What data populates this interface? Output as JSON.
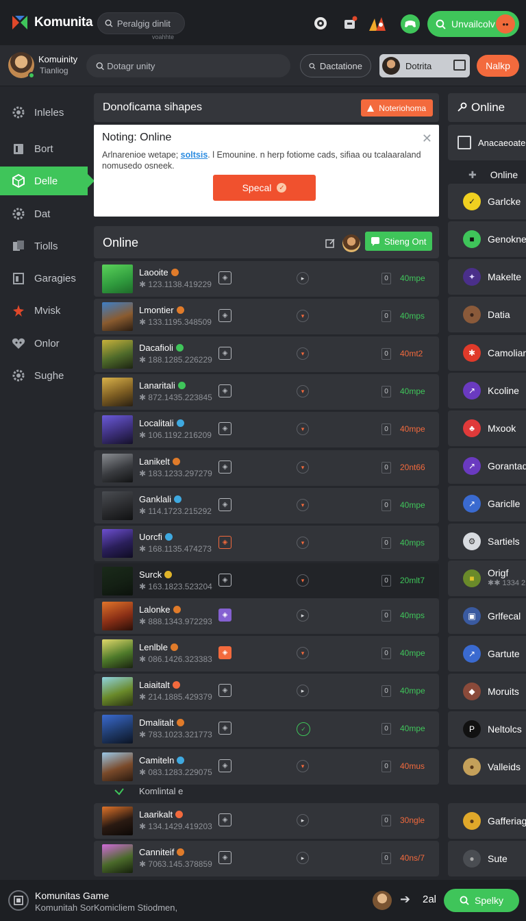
{
  "app": {
    "brand_name": "Komunita",
    "search_placeholder": "Peralgig dinlit",
    "search_hint": "voahhte",
    "cta_label": "Unvailcolv"
  },
  "subheader": {
    "user_name": "Komuinity",
    "user_sub": "Tianliog",
    "search_placeholder": "Dotagr unity",
    "pill_label": "Dactatione",
    "account_label": "Dotrita",
    "action_label": "Nalkp"
  },
  "sidebar": {
    "items": [
      {
        "label": "Inleles",
        "icon": "gear-icon"
      },
      {
        "label": "Bort",
        "icon": "book-icon"
      },
      {
        "label": "Delle",
        "icon": "cube-icon"
      },
      {
        "label": "Dat",
        "icon": "gear-icon"
      },
      {
        "label": "Tiolls",
        "icon": "cards-icon"
      },
      {
        "label": "Garagies",
        "icon": "garage-icon"
      },
      {
        "label": "Mvisk",
        "icon": "star-icon"
      },
      {
        "label": "Onlor",
        "icon": "heart-icon"
      },
      {
        "label": "Sughe",
        "icon": "gear-icon"
      }
    ],
    "active_index": 2
  },
  "notification": {
    "title": "Donoficama sihapes",
    "tag_label": "Noteriohoma",
    "dialog_title": "Noting: Online",
    "dialog_text_before": "Arlnarenioe wetape;",
    "dialog_link": "soltsis",
    "dialog_text_after": ". l Emounine. n herp fotiome cads, sifiaa ou tcalaaraland nomusedo osneek.",
    "dialog_button": "Specal"
  },
  "online": {
    "title": "Online",
    "chip_label": "Stieng Ont",
    "section_label": "Komlintal e",
    "rows": [
      {
        "name": "Laooite",
        "id": "✱ 123.1138.419229",
        "status": "neutral",
        "count": "0",
        "time": "40mpe",
        "time_color": "#3fc55a",
        "badge": "#e07b2a",
        "shield": "plain",
        "thumb": "linear-gradient(160deg,#5ad25a,#2f9a3d 60%,#1f6a2a)"
      },
      {
        "name": "Lmontier",
        "id": "✱ 133.1195.348509",
        "status": "red",
        "count": "0",
        "time": "40mps",
        "time_color": "#3fc55a",
        "badge": "#e07b2a",
        "shield": "plain",
        "thumb": "linear-gradient(160deg,#3d7fc7,#8a5b2f 55%,#2a1d12)"
      },
      {
        "name": "Dacafioli",
        "id": "✱ 188.1285.226229",
        "status": "red",
        "count": "0",
        "time": "40mt2",
        "time_color": "#f36a3d",
        "badge": "#3fc55a",
        "shield": "plain",
        "thumb": "linear-gradient(160deg,#c7b13b,#4e6a2a 55%,#1d2412)"
      },
      {
        "name": "Lanaritali",
        "id": "✱ 872.1435.223845",
        "status": "red",
        "count": "0",
        "time": "40mpe",
        "time_color": "#3fc55a",
        "badge": "#3fc55a",
        "shield": "plain",
        "thumb": "linear-gradient(160deg,#d9b24a,#7d5d22 55%,#2a2012)"
      },
      {
        "name": "Localitali",
        "id": "✱ 106.1192.216209",
        "status": "red",
        "count": "0",
        "time": "40mpe",
        "time_color": "#f36a3d",
        "badge": "#3fa9e0",
        "shield": "plain",
        "thumb": "linear-gradient(160deg,#6a5ad9,#3c2f7a 55%,#15112a)"
      },
      {
        "name": "Lanikelt",
        "id": "✱ 183.1233.297279",
        "status": "red",
        "count": "0",
        "time": "20nt66",
        "time_color": "#f36a3d",
        "badge": "#e07b2a",
        "shield": "plain",
        "thumb": "linear-gradient(160deg,#8a8d92,#3a3c40 55%,#121314)"
      },
      {
        "name": "Ganklali",
        "id": "✱ 114.1723.215292",
        "status": "red",
        "count": "0",
        "time": "40mpe",
        "time_color": "#3fc55a",
        "badge": "#3fa9e0",
        "shield": "plain",
        "thumb": "linear-gradient(160deg,#4a4d52,#2a2b2e 55%,#101112)"
      },
      {
        "name": "Uorcfi",
        "id": "✱ 168.1135.474273",
        "status": "red",
        "count": "0",
        "time": "40mps",
        "time_color": "#3fc55a",
        "badge": "#3fa9e0",
        "shield": "red-outline",
        "thumb": "linear-gradient(160deg,#6d4fd0,#2a1f5a 55%,#0f0c22)"
      },
      {
        "name": "Surck",
        "id": "✱ 163.1823.523204",
        "status": "red",
        "count": "0",
        "time": "20mlt7",
        "time_color": "#3fc55a",
        "badge": "#e0b42a",
        "shield": "plain",
        "thumb": "linear-gradient(160deg,#1a2a1a,#142014 55%,#0c120c)",
        "dark": true
      },
      {
        "name": "Lalonke",
        "id": "✱ 888.1343.972293",
        "status": "neutral",
        "count": "0",
        "time": "40mps",
        "time_color": "#3fc55a",
        "badge": "#e07b2a",
        "shield": "purple",
        "thumb": "linear-gradient(160deg,#e0742a,#8a2f16 55%,#2a0f08)"
      },
      {
        "name": "Lenlble",
        "id": "✱ 086.1426.323383",
        "status": "red",
        "count": "0",
        "time": "40mpe",
        "time_color": "#3fc55a",
        "badge": "#e07b2a",
        "shield": "red",
        "thumb": "linear-gradient(160deg,#e0d86a,#4e7a2a 55%,#1a2410)"
      },
      {
        "name": "Laiaitalt",
        "id": "✱ 214.1885.429379",
        "status": "neutral",
        "count": "0",
        "time": "40mpe",
        "time_color": "#3fc55a",
        "badge": "#f36a3d",
        "shield": "plain",
        "thumb": "linear-gradient(160deg,#8fd3e0,#6a8a2a 55%,#2a3412)"
      },
      {
        "name": "Dmalitalt",
        "id": "✱ 783.1023.321773",
        "status": "green",
        "count": "0",
        "time": "40mpe",
        "time_color": "#3fc55a",
        "badge": "#e07b2a",
        "shield": "plain",
        "thumb": "linear-gradient(160deg,#3a6ad0,#1f3a6a 55%,#0c1424)"
      },
      {
        "name": "Camiteln",
        "id": "✱ 083.1283.229075",
        "status": "red",
        "count": "0",
        "time": "40mus",
        "time_color": "#f36a3d",
        "badge": "#3fa9e0",
        "shield": "plain",
        "thumb": "linear-gradient(160deg,#9ac8e8,#7a4a2a 55%,#2a1a10)"
      },
      {
        "name": "Laarikalt",
        "id": "✱ 134.1429.419203",
        "status": "neutral",
        "count": "0",
        "time": "30ngle",
        "time_color": "#f36a3d",
        "badge": "#f36a3d",
        "shield": "plain",
        "thumb": "linear-gradient(160deg,#e0742a,#2a1a12 55%,#0c0806)"
      },
      {
        "name": "Canniteif",
        "id": "✱ 7063.145.378859",
        "status": "neutral",
        "count": "0",
        "time": "40ns/7",
        "time_color": "#f36a3d",
        "badge": "#e07b2a",
        "shield": "plain",
        "thumb": "linear-gradient(160deg,#d06ad9,#4a6a2a 55%,#16200c)"
      }
    ]
  },
  "right_panel": {
    "title": "Online",
    "header_item": "Anacaeoate",
    "plain_item": "Online",
    "items": [
      {
        "label": "Garlcke",
        "icon_bg": "#f0d020",
        "glyph": "✓",
        "glyph_color": "#222"
      },
      {
        "label": "Genoknes",
        "icon_bg": "#3fc55a",
        "glyph": "■",
        "glyph_color": "#111"
      },
      {
        "label": "Makelte",
        "icon_bg": "#4a2f8a",
        "glyph": "✦",
        "glyph_color": "#e0d8ff"
      },
      {
        "label": "Datia",
        "icon_bg": "#8a5a3a",
        "glyph": "●",
        "glyph_color": "#3a241a"
      },
      {
        "label": "Camoliarc",
        "icon_bg": "#e03a2a",
        "glyph": "✱",
        "glyph_color": "#fff"
      },
      {
        "label": "Kcoline",
        "icon_bg": "#6a3ac0",
        "glyph": "↗",
        "glyph_color": "#fff"
      },
      {
        "label": "Mxook",
        "icon_bg": "#e03a3a",
        "glyph": "♣",
        "glyph_color": "#fff"
      },
      {
        "label": "Gorantadi",
        "icon_bg": "#6a3ac0",
        "glyph": "↗",
        "glyph_color": "#fff"
      },
      {
        "label": "Gariclle",
        "icon_bg": "#3a6ad0",
        "glyph": "↗",
        "glyph_color": "#fff"
      },
      {
        "label": "Sartiels",
        "icon_bg": "#d8dbe0",
        "glyph": "⚙",
        "glyph_color": "#333"
      },
      {
        "label": "Origf",
        "icon_bg": "#6a8a2a",
        "glyph": "■",
        "glyph_color": "#e0c42a",
        "sub": "✱✱ 1334 2"
      },
      {
        "label": "Grlfecal",
        "icon_bg": "#3a5aa0",
        "glyph": "▣",
        "glyph_color": "#fff"
      },
      {
        "label": "Gartute",
        "icon_bg": "#3a6ad0",
        "glyph": "↗",
        "glyph_color": "#fff"
      },
      {
        "label": "Moruits",
        "icon_bg": "#8a4a3a",
        "glyph": "◆",
        "glyph_color": "#fff"
      },
      {
        "label": "Neltolcs",
        "icon_bg": "#111",
        "glyph": "P",
        "glyph_color": "#fff"
      },
      {
        "label": "Valleids",
        "icon_bg": "#c4a05a",
        "glyph": "●",
        "glyph_color": "#5a3a1a"
      },
      {
        "label": "Gafferiag",
        "icon_bg": "#e0a82a",
        "glyph": "●",
        "glyph_color": "#5a3a1a"
      },
      {
        "label": "Sute",
        "icon_bg": "#4a4d52",
        "glyph": "●",
        "glyph_color": "#aaa"
      }
    ]
  },
  "bottombar": {
    "title": "Komunitas Game",
    "subtitle": "Komunitah SorKomicliem Stiodmen,",
    "count": "2al",
    "button_label": "Spelky"
  },
  "colors": {
    "accent_green": "#3fc55a",
    "accent_orange": "#f36a3d",
    "background": "#25272c"
  }
}
